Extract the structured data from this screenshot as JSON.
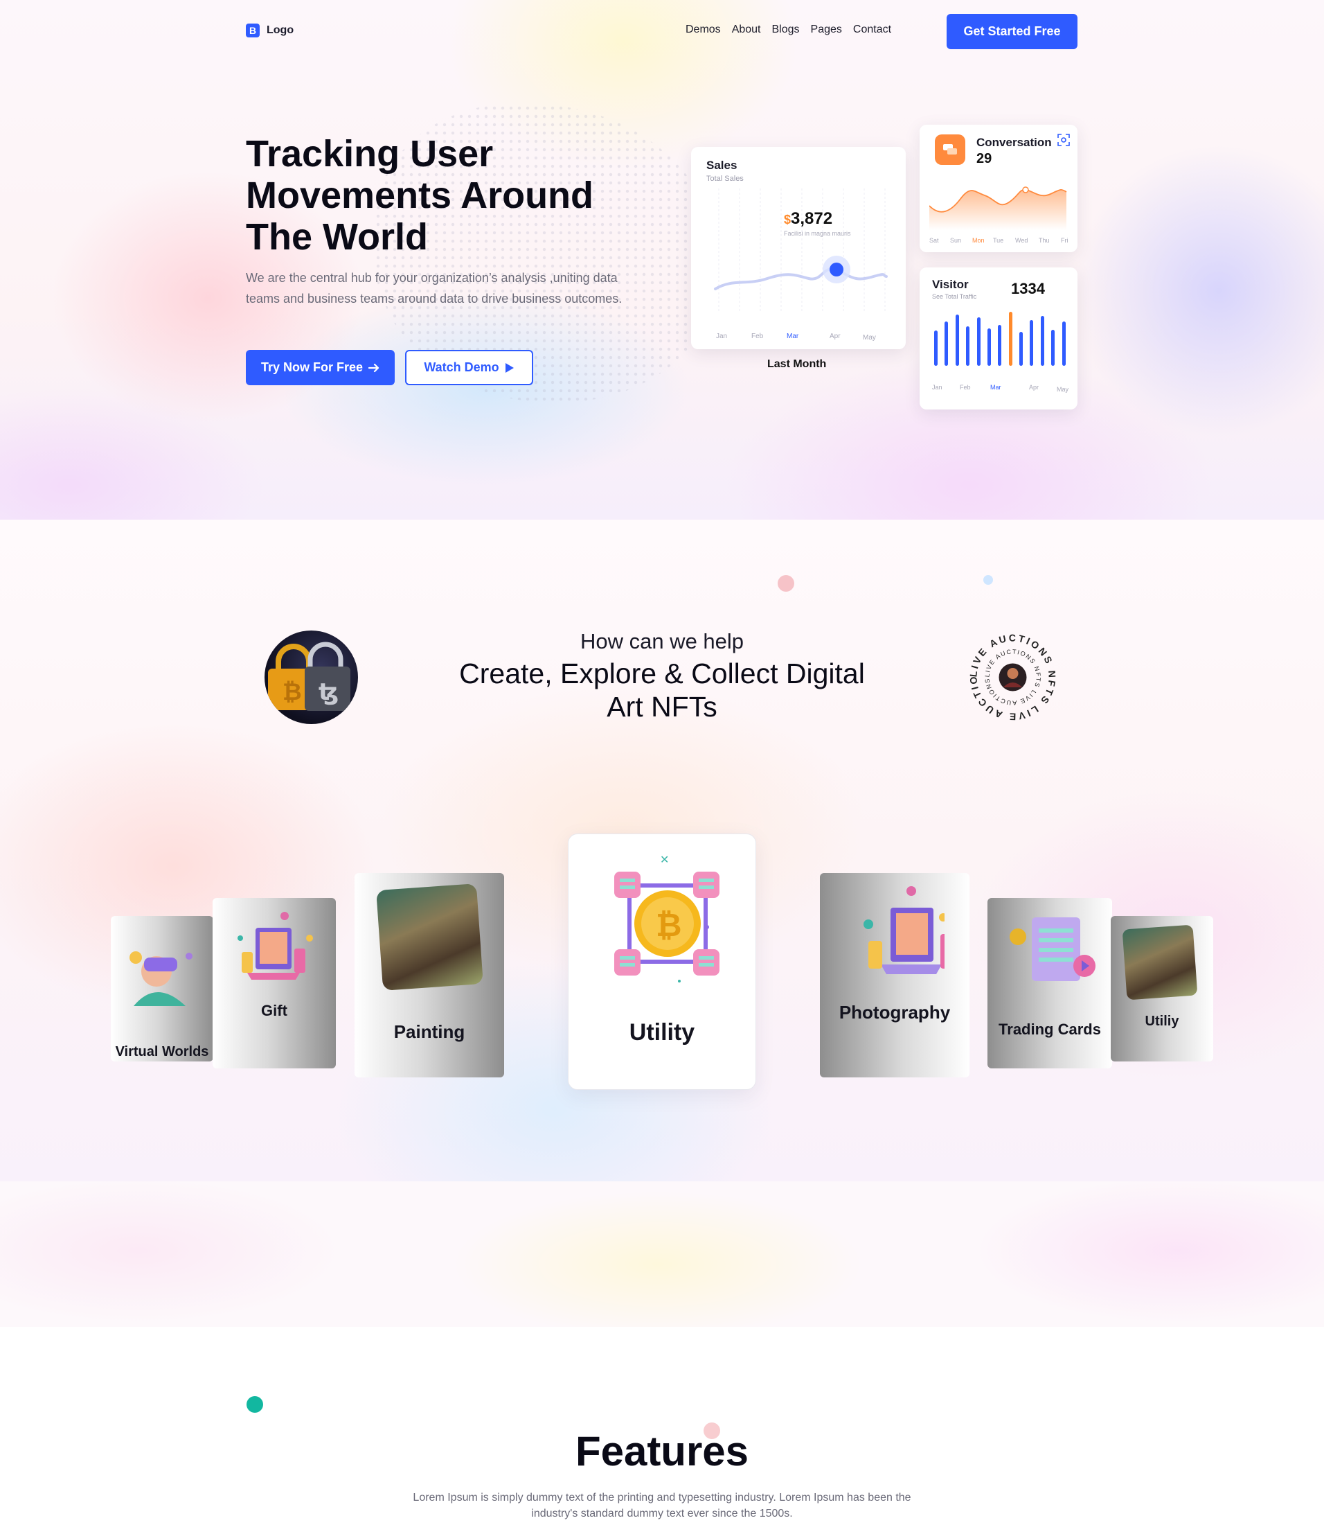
{
  "brand": {
    "logo_mark": "B",
    "logo_text": "Logo"
  },
  "nav": {
    "items": [
      "Demos",
      "About",
      "Blogs",
      "Pages",
      "Contact"
    ],
    "cta_label": "Get Started Free"
  },
  "hero": {
    "title": "Tracking User Movements Around The World",
    "subtitle": "We are the central hub for your organization’s analysis ,uniting data teams and business teams around data to drive business outcomes.",
    "primary_button": "Try Now For Free",
    "secondary_button": "Watch Demo"
  },
  "sales_card": {
    "title": "Sales",
    "subtitle": "Total Sales",
    "currency": "$",
    "value": "3,872",
    "value_caption": "Facilisi in magna mauris",
    "months": [
      "Jan",
      "Feb",
      "Mar",
      "Apr",
      "May"
    ],
    "active_month": "Mar",
    "footer": "Last Month"
  },
  "conversation_card": {
    "title": "Conversation",
    "value": "29",
    "days": [
      "Sat",
      "Sun",
      "Mon",
      "Tue",
      "Wed",
      "Thu",
      "Fri"
    ],
    "active_day": "Mon"
  },
  "visitor_card": {
    "title": "Visitor",
    "subtitle": "See Total Traffic",
    "value": "1334",
    "months": [
      "Jan",
      "Feb",
      "Mar",
      "Apr",
      "May"
    ],
    "active_month": "Mar",
    "bars": [
      0.62,
      0.78,
      0.9,
      0.7,
      0.85,
      0.66,
      0.72,
      0.95,
      0.6,
      0.8,
      0.88,
      0.64,
      0.78
    ],
    "highlight_bar_index": 7
  },
  "help_section": {
    "subtitle": "How can we help",
    "title": "Create, Explore & Collect Digital Art NFTs",
    "badge_text": "LIVE AUCTIONS NFTS LIVE AUCTIONS NFTS"
  },
  "categories": [
    {
      "label": "Virtual Worlds",
      "icon": "vr-headset-icon"
    },
    {
      "label": "Gift",
      "icon": "gift-frame-icon"
    },
    {
      "label": "Painting",
      "icon": "painting-icon"
    },
    {
      "label": "Utility",
      "icon": "bitcoin-icon"
    },
    {
      "label": "Photography",
      "icon": "photo-frame-icon"
    },
    {
      "label": "Trading Cards",
      "icon": "scroll-icon"
    },
    {
      "label": "Utiliy",
      "icon": "artwork-icon"
    }
  ],
  "features": {
    "title": "Features",
    "text": "Lorem Ipsum is simply dummy text of the printing and typesetting industry. Lorem Ipsum has been the industry's standard dummy text ever since the 1500s."
  },
  "colors": {
    "primary": "#2f5bff",
    "accent_orange": "#ff8a2b",
    "text_dark": "#0a0a16",
    "text_muted": "#6a6a78"
  }
}
